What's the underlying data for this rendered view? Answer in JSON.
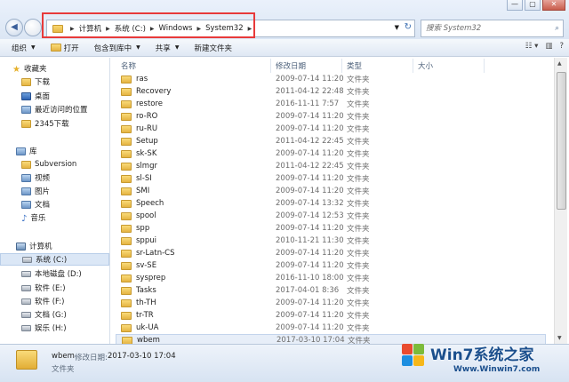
{
  "window": {
    "controls": [
      "—",
      "▢",
      "✕"
    ]
  },
  "address_bar": {
    "segments": [
      "计算机",
      "系统 (C:)",
      "Windows",
      "System32"
    ]
  },
  "search": {
    "placeholder": "搜索 System32"
  },
  "toolbar": {
    "organize": "组织",
    "open": "打开",
    "include_in_library": "包含到库中",
    "share": "共享",
    "new_folder": "新建文件夹"
  },
  "sidebar": {
    "favorites": "收藏夹",
    "items_fav": [
      "下载",
      "桌面",
      "最近访问的位置",
      "2345下载"
    ],
    "libraries": "库",
    "items_lib": [
      "Subversion",
      "视频",
      "图片",
      "文档",
      "音乐"
    ],
    "computer": "计算机",
    "drives": [
      "系统 (C:)",
      "本地磁盘 (D:)",
      "软件 (E:)",
      "软件 (F:)",
      "文档 (G:)",
      "娱乐 (H:)"
    ]
  },
  "columns": {
    "name": "名称",
    "modified": "修改日期",
    "type": "类型",
    "size": "大小"
  },
  "files": [
    {
      "name": "ras",
      "date": "2009-07-14 11:20",
      "type": "文件夹"
    },
    {
      "name": "Recovery",
      "date": "2011-04-12 22:48",
      "type": "文件夹"
    },
    {
      "name": "restore",
      "date": "2016-11-11 7:57",
      "type": "文件夹"
    },
    {
      "name": "ro-RO",
      "date": "2009-07-14 11:20",
      "type": "文件夹"
    },
    {
      "name": "ru-RU",
      "date": "2009-07-14 11:20",
      "type": "文件夹"
    },
    {
      "name": "Setup",
      "date": "2011-04-12 22:45",
      "type": "文件夹"
    },
    {
      "name": "sk-SK",
      "date": "2009-07-14 11:20",
      "type": "文件夹"
    },
    {
      "name": "slmgr",
      "date": "2011-04-12 22:45",
      "type": "文件夹"
    },
    {
      "name": "sl-SI",
      "date": "2009-07-14 11:20",
      "type": "文件夹"
    },
    {
      "name": "SMI",
      "date": "2009-07-14 11:20",
      "type": "文件夹"
    },
    {
      "name": "Speech",
      "date": "2009-07-14 13:32",
      "type": "文件夹"
    },
    {
      "name": "spool",
      "date": "2009-07-14 12:53",
      "type": "文件夹"
    },
    {
      "name": "spp",
      "date": "2009-07-14 11:20",
      "type": "文件夹"
    },
    {
      "name": "sppui",
      "date": "2010-11-21 11:30",
      "type": "文件夹"
    },
    {
      "name": "sr-Latn-CS",
      "date": "2009-07-14 11:20",
      "type": "文件夹"
    },
    {
      "name": "sv-SE",
      "date": "2009-07-14 11:20",
      "type": "文件夹"
    },
    {
      "name": "sysprep",
      "date": "2016-11-10 18:00",
      "type": "文件夹"
    },
    {
      "name": "Tasks",
      "date": "2017-04-01 8:36",
      "type": "文件夹"
    },
    {
      "name": "th-TH",
      "date": "2009-07-14 11:20",
      "type": "文件夹"
    },
    {
      "name": "tr-TR",
      "date": "2009-07-14 11:20",
      "type": "文件夹"
    },
    {
      "name": "uk-UA",
      "date": "2009-07-14 11:20",
      "type": "文件夹"
    },
    {
      "name": "wbem",
      "date": "2017-03-10 17:04",
      "type": "文件夹"
    }
  ],
  "selected_index": 21,
  "status": {
    "name": "wbem",
    "modified_label": "修改日期:",
    "modified_value": "2017-03-10 17:04",
    "type": "文件夹"
  },
  "watermark": {
    "brand": "Win7系统之家",
    "url": "Www.Winwin7.com"
  }
}
